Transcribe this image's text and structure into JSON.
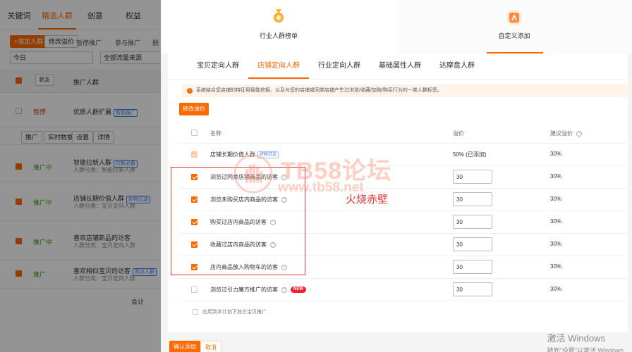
{
  "background": {
    "tabs": [
      "关键词",
      "精选人群",
      "创意",
      "权益"
    ],
    "active_tab": 1,
    "buttons": {
      "add_crowd": "+添加人群",
      "edit_bid": "修改溢价",
      "pause": "暂停推广",
      "join": "参与推广",
      "delete": "删"
    },
    "select_today": "今日",
    "select_all_flow": "全部流量来源",
    "header": {
      "state": "状态",
      "crowd": "推广人群"
    },
    "rows": [
      {
        "status": "暂停",
        "name": "优质人群扩展",
        "badge": "智能推广",
        "sub": "",
        "checked": false
      },
      {
        "status": "推广中",
        "name": "智能拉新人群",
        "badge": "拉新必备",
        "sub": "人群分类：智能拉新人群",
        "checked": true
      },
      {
        "status": "推广中",
        "name": "店铺长期价值人群",
        "badge": "好物沉淀",
        "sub": "人群分类：宝贝定向人群",
        "checked": true
      },
      {
        "status": "推广中",
        "name": "喜欢店铺新品的访客",
        "badge": "",
        "sub": "人群分类：宝贝定向人群",
        "checked": true
      },
      {
        "status": "推广",
        "name": "喜欢相似宝贝的访客",
        "badge": "高点人群",
        "sub": "人群分类：宝贝定向人群",
        "checked": true
      }
    ],
    "row_actions": [
      "推广",
      "实时数据",
      "设置",
      "详情"
    ],
    "total_label": "合计"
  },
  "modal": {
    "top_cards": [
      {
        "label": "行业人群榜单",
        "icon": "medal-icon"
      },
      {
        "label": "自定义添加",
        "icon": "custom-add-icon"
      }
    ],
    "active_card": 1,
    "segment_tabs": [
      "宝贝定向人群",
      "店铺定向人群",
      "行业定向人群",
      "基础属性人群",
      "达摩盘人群"
    ],
    "active_segment": 1,
    "notice": "系统结合您店铺的特征用智能挖掘、以及与您的店铺或同类店铺产生过浏览/收藏/加购/购买行为的一类人群标签。",
    "edit_button": "修改溢价",
    "columns": {
      "name": "名称",
      "bid": "溢价",
      "suggested": "建议溢价"
    },
    "rows": [
      {
        "name": "店铺长期价值人群",
        "tag": "好物沉淀",
        "bid": "50% (已添加)",
        "bid_is_text": true,
        "suggested": "30%",
        "checked": true,
        "disabled": true,
        "new": false
      },
      {
        "name": "浏览过同类店铺商品的访客",
        "tag": "",
        "bid": "30",
        "bid_is_text": false,
        "suggested": "30%",
        "checked": true,
        "disabled": false,
        "new": false
      },
      {
        "name": "浏览未购买店内商品的访客",
        "tag": "",
        "bid": "30",
        "bid_is_text": false,
        "suggested": "30%",
        "checked": true,
        "disabled": false,
        "new": false
      },
      {
        "name": "购买过店内商品的访客",
        "tag": "",
        "bid": "30",
        "bid_is_text": false,
        "suggested": "30%",
        "checked": true,
        "disabled": false,
        "new": false
      },
      {
        "name": "收藏过店内商品的访客",
        "tag": "",
        "bid": "30",
        "bid_is_text": false,
        "suggested": "30%",
        "checked": true,
        "disabled": false,
        "new": false
      },
      {
        "name": "店内商品放入购物车的访客",
        "tag": "",
        "bid": "30",
        "bid_is_text": false,
        "suggested": "30%",
        "checked": true,
        "disabled": false,
        "new": false
      },
      {
        "name": "浏览过引力魔方推广的访客",
        "tag": "",
        "bid": "30",
        "bid_is_text": false,
        "suggested": "30%",
        "checked": false,
        "disabled": false,
        "new": true
      }
    ],
    "new_label": "NEW",
    "apply_all": "应用到本计划下其它宝贝推广",
    "confirm": "确认添加",
    "cancel": "取消"
  },
  "annotation": "火烧赤壁",
  "watermark": {
    "title": "TB58论坛",
    "url": "www.tb58.net"
  },
  "windows_watermark": {
    "line1": "激活 Windows",
    "line2": "转到\"设置\"以激活 Windows"
  },
  "colors": {
    "accent": "#ff6a00",
    "annotation": "#e53935",
    "tag_blue": "#3b82f6",
    "new_red": "#f5222d"
  }
}
